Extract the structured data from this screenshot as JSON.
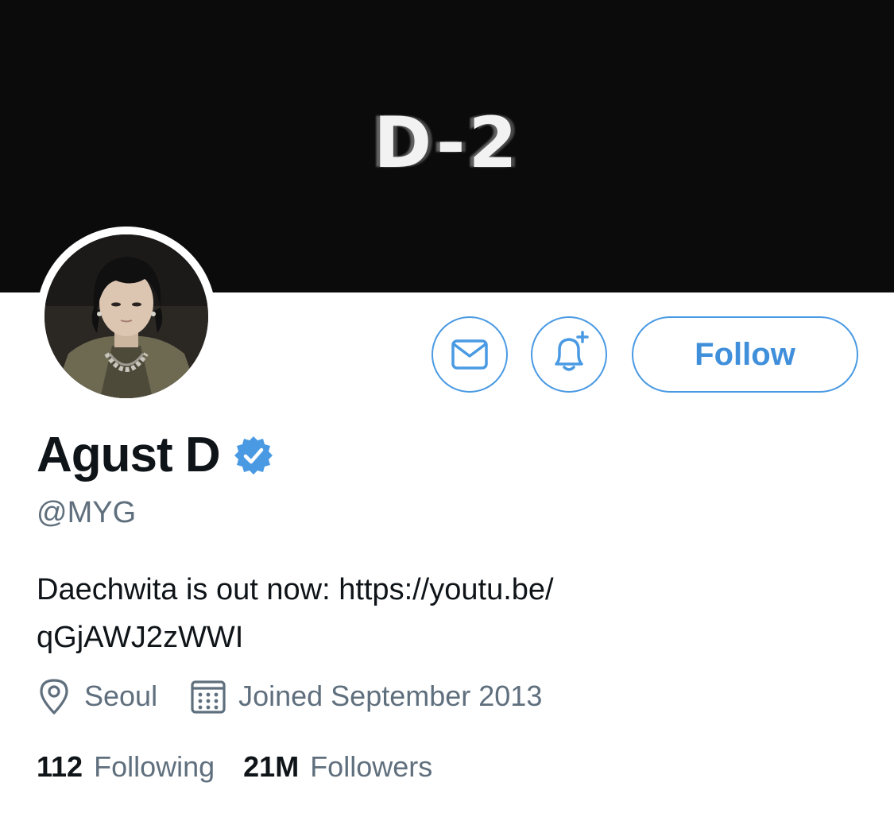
{
  "banner": {
    "text": "D-2"
  },
  "profile": {
    "name": "Agust D",
    "handle": "@MYG",
    "bio_prefix": "Daechwita is out now: ",
    "bio_link_line1": "https://youtu.be/",
    "bio_link_line2": "qGjAWJ2zWWI",
    "location": "Seoul",
    "joined": "Joined September 2013",
    "verified": true
  },
  "actions": {
    "message_icon": "envelope-icon",
    "notify_icon": "bell-plus-icon",
    "follow_label": "Follow"
  },
  "stats": {
    "following_count": "112",
    "following_label": "Following",
    "followers_count": "21M",
    "followers_label": "Followers"
  },
  "colors": {
    "accent": "#4a9ae3",
    "text_primary": "#0f1419",
    "text_secondary": "#5f6f7d",
    "banner_bg": "#0b0b0b"
  }
}
